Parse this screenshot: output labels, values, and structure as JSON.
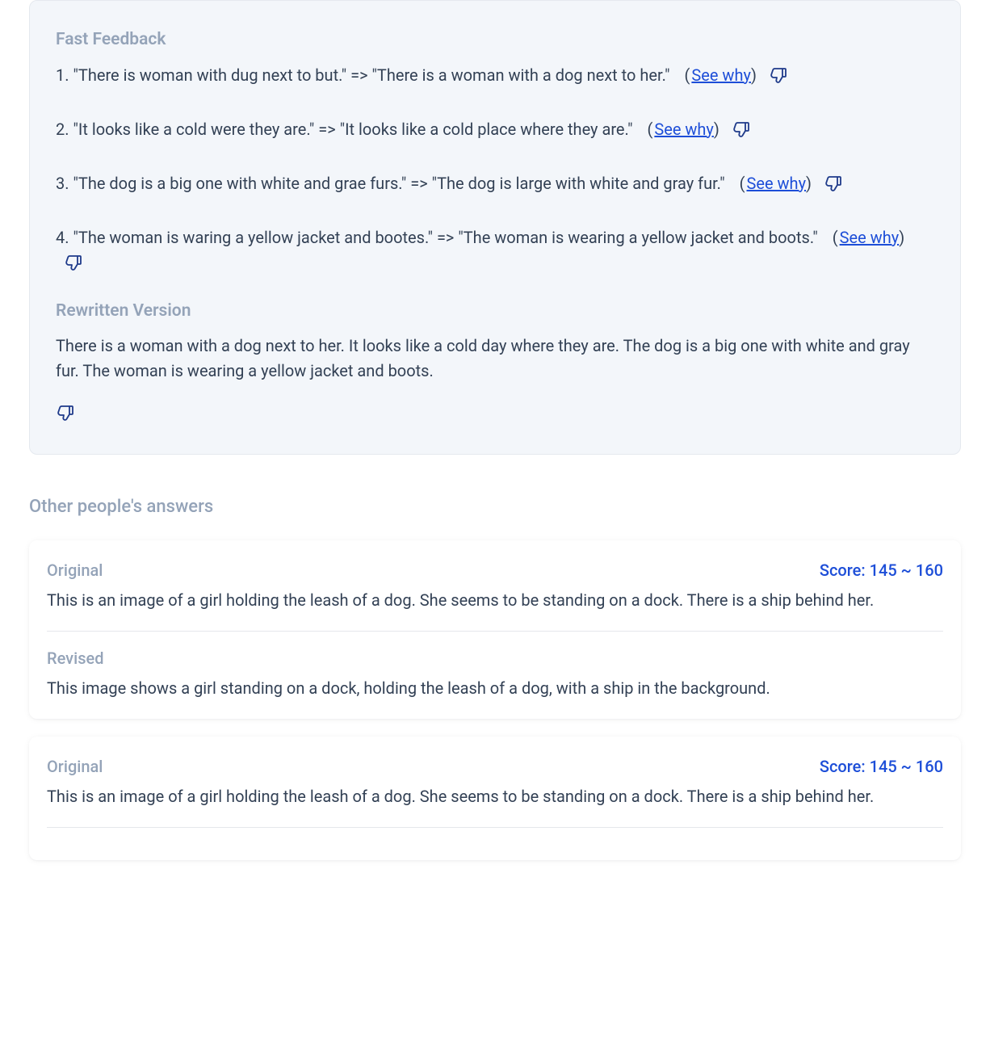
{
  "feedback": {
    "title": "Fast Feedback",
    "see_why_label": "See why",
    "items": [
      {
        "num": "1.",
        "text": "\"There is woman with dug next to but.\" => \"There is a woman with a dog next to her.\""
      },
      {
        "num": "2.",
        "text": "\"It looks like a cold were they are.\" => \"It looks like a cold place where they are.\""
      },
      {
        "num": "3.",
        "text": "\"The dog is a big one with white and grae furs.\" => \"The dog is large with white and gray fur.\""
      },
      {
        "num": "4.",
        "text": "\"The woman is waring a yellow jacket and bootes.\" => \"The woman is wearing a yellow jacket and boots.\""
      }
    ],
    "rewritten_title": "Rewritten Version",
    "rewritten_text": "There is a woman with a dog next to her. It looks like a cold day where they are. The dog is a big one with white and gray fur. The woman is wearing a yellow jacket and boots."
  },
  "others": {
    "title": "Other people's answers",
    "answers": [
      {
        "original_label": "Original",
        "score": "Score: 145 ~ 160",
        "original_text": "This is an image of a girl holding the leash of a dog. She seems to be standing on a dock. There is a ship behind her.",
        "revised_label": "Revised",
        "revised_text": "This image shows a girl standing on a dock, holding the leash of a dog, with a ship in the background."
      },
      {
        "original_label": "Original",
        "score": "Score: 145 ~ 160",
        "original_text": "This is an image of a girl holding the leash of a dog. She seems to be standing on a dock. There is a ship behind her."
      }
    ]
  }
}
